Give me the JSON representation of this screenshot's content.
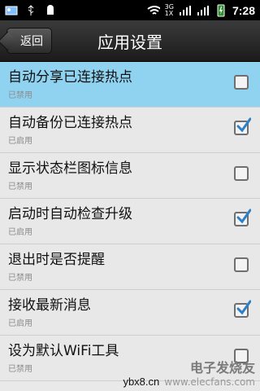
{
  "status_bar": {
    "time": "7:28",
    "network_top": "3G",
    "network_bottom": "1X",
    "icons": [
      "photo-icon",
      "usb-icon",
      "android-icon",
      "wifi-icon",
      "signal-icon",
      "signal-icon",
      "battery-charging-icon"
    ]
  },
  "header": {
    "back_label": "返回",
    "title": "应用设置"
  },
  "settings": [
    {
      "title": "自动分享已连接热点",
      "status": "已禁用",
      "checked": false,
      "highlighted": true
    },
    {
      "title": "自动备份已连接热点",
      "status": "已启用",
      "checked": true,
      "highlighted": false
    },
    {
      "title": "显示状态栏图标信息",
      "status": "已禁用",
      "checked": false,
      "highlighted": false
    },
    {
      "title": "启动时自动检查升级",
      "status": "已启用",
      "checked": true,
      "highlighted": false
    },
    {
      "title": "退出时是否提醒",
      "status": "已禁用",
      "checked": false,
      "highlighted": false
    },
    {
      "title": "接收最新消息",
      "status": "已启用",
      "checked": true,
      "highlighted": false
    },
    {
      "title": "设为默认WiFi工具",
      "status": "已禁用",
      "checked": false,
      "highlighted": false
    }
  ],
  "watermark": {
    "site_text": "ybx8.cn",
    "logo_main": "电子发烧友",
    "logo_sub": "www.elecfans.com"
  },
  "colors": {
    "highlight": "#8fd3f1",
    "check_blue": "#2b80c9"
  }
}
